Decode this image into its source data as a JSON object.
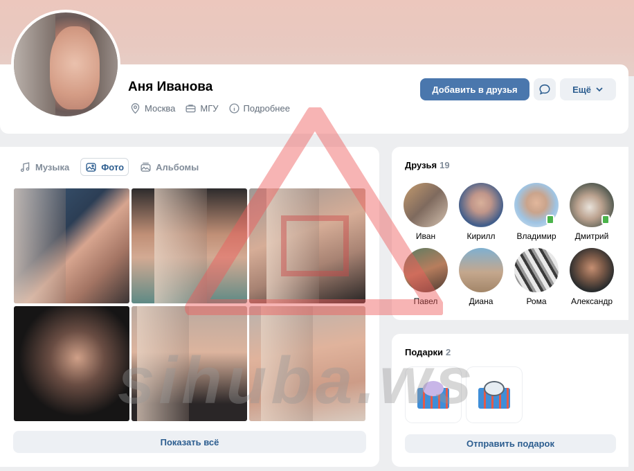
{
  "profile": {
    "name": "Аня Иванова",
    "city": "Москва",
    "university": "МГУ",
    "more_info": "Подробнее",
    "icons": {
      "city": "location-pin-icon",
      "university": "briefcase-icon",
      "more_info": "info-icon"
    }
  },
  "actions": {
    "add_friend": "Добавить в друзья",
    "message_icon": "chat-bubble-icon",
    "more": "Ещё",
    "more_icon": "chevron-down-icon"
  },
  "media_tabs": [
    {
      "label": "Музыка",
      "icon": "music-note-icon",
      "active": false
    },
    {
      "label": "Фото",
      "icon": "photo-icon",
      "active": true
    },
    {
      "label": "Альбомы",
      "icon": "albums-icon",
      "active": false
    }
  ],
  "photos": {
    "count_visible": 6,
    "show_all": "Показать всё"
  },
  "friends": {
    "title": "Друзья",
    "count": "19",
    "items": [
      {
        "name": "Иван",
        "online": false
      },
      {
        "name": "Кирилл",
        "online": false
      },
      {
        "name": "Владимир",
        "online": true
      },
      {
        "name": "Дмитрий",
        "online": true
      },
      {
        "name": "Павел",
        "online": false
      },
      {
        "name": "Диана",
        "online": false
      },
      {
        "name": "Рома",
        "online": false
      },
      {
        "name": "Александр",
        "online": false
      }
    ]
  },
  "gifts": {
    "title": "Подарки",
    "count": "2",
    "send": "Отправить подарок"
  },
  "watermark": {
    "text": "sihuba.ws"
  },
  "colors": {
    "accent": "#4a77ad",
    "link": "#2c5d8f",
    "online": "#4bb34b",
    "bg": "#edeef0"
  }
}
